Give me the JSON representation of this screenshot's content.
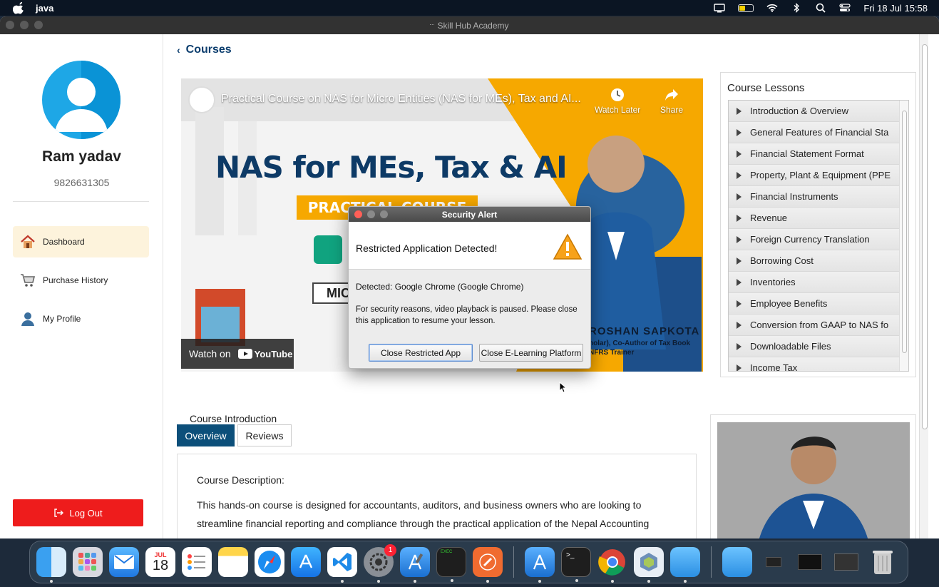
{
  "menubar": {
    "app_name": "java",
    "datetime": "Fri 18 Jul  15:58"
  },
  "window": {
    "title": "Skill Hub Academy"
  },
  "sidebar": {
    "user_name": "Ram yadav",
    "user_phone": "9826631305",
    "nav": [
      {
        "label": "Dashboard",
        "icon": "house-icon"
      },
      {
        "label": "Purchase History",
        "icon": "cart-icon"
      },
      {
        "label": "My Profile",
        "icon": "person-icon"
      }
    ],
    "logout_label": "Log Out"
  },
  "main": {
    "back_label": "Courses",
    "video": {
      "title": "Practical Course on NAS for Micro Entities (NAS for MEs), Tax and AI...",
      "watch_later": "Watch Later",
      "share": "Share",
      "headline": "NAS for MEs, Tax & AI",
      "badge": "PRACTICAL COURSE",
      "mic_text": "MIC",
      "speaker_name": "ROSHAN SAPKOTA",
      "speaker_role": "holar), Co-Author of Tax Book",
      "speaker_role2": "NFRS Trainer",
      "watch_on": "Watch on",
      "youtube": "YouTube"
    },
    "lessons_title": "Course Lessons",
    "lessons": [
      "Introduction & Overview",
      "General Features of Financial Sta",
      "Financial Statement Format",
      "Property, Plant & Equipment (PPE",
      "Financial Instruments",
      "Revenue",
      "Foreign Currency Translation",
      "Borrowing Cost",
      "Inventories",
      "Employee Benefits",
      "Conversion from GAAP to NAS fo",
      "Downloadable Files",
      "Income Tax"
    ],
    "intro_label": "Course Introduction",
    "tabs": {
      "overview": "Overview",
      "reviews": "Reviews"
    },
    "description_title": "Course Description:",
    "description_line1": "This hands-on course is designed for accountants, auditors, and business owners who are looking to",
    "description_line2": "streamline financial reporting and compliance through the practical application of the Nepal Accounting"
  },
  "dialog": {
    "title": "Security Alert",
    "message": "Restricted Application Detected!",
    "detected": "Detected: Google Chrome (Google Chrome)",
    "body": "For security reasons, video playback is paused. Please close this application to resume your lesson.",
    "btn_close_app": "Close Restricted App",
    "btn_close_platform": "Close E-Learning Platform"
  },
  "dock": {
    "calendar_month": "JUL",
    "calendar_day": "18",
    "settings_badge": "1"
  },
  "colors": {
    "accent_navy": "#0c3e6e",
    "tab_active": "#0c4f7a",
    "logout_red": "#ee1c1c",
    "nav_active_bg": "#fdf3dc",
    "video_orange": "#f6a800"
  }
}
